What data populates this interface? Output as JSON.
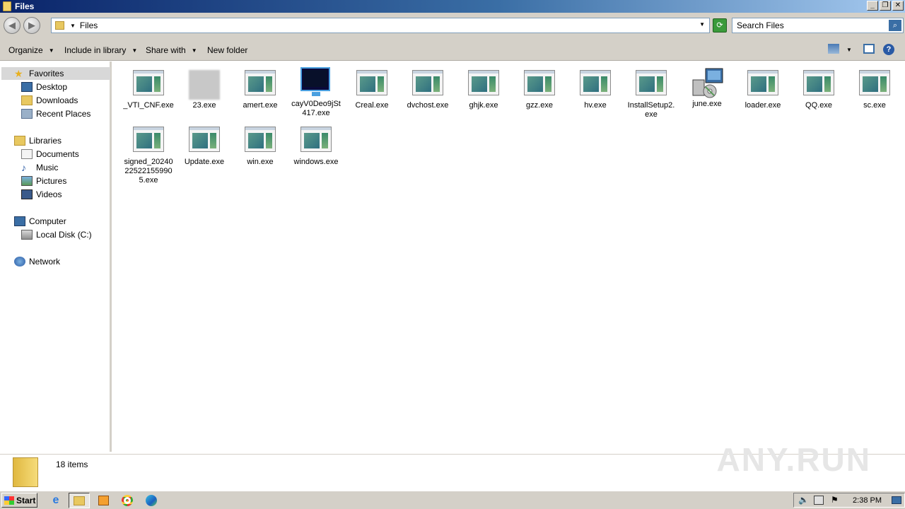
{
  "window": {
    "title": "Files",
    "buttons": {
      "minimize": "_",
      "restore": "❐",
      "close": "✕"
    }
  },
  "address": {
    "path": "Files",
    "search_placeholder": "Search Files"
  },
  "toolbar": {
    "organize": "Organize",
    "include_in_library": "Include in library",
    "share_with": "Share with",
    "new_folder": "New folder"
  },
  "nav": {
    "favorites": "Favorites",
    "desktop": "Desktop",
    "downloads": "Downloads",
    "recent_places": "Recent Places",
    "libraries": "Libraries",
    "documents": "Documents",
    "music": "Music",
    "pictures": "Pictures",
    "videos": "Videos",
    "computer": "Computer",
    "local_disk": "Local Disk (C:)",
    "network": "Network"
  },
  "files": [
    {
      "name": "_VTI_CNF.exe",
      "icon": "exe-icon"
    },
    {
      "name": "23.exe",
      "icon": "blurred-icon"
    },
    {
      "name": "amert.exe",
      "icon": "exe-icon"
    },
    {
      "name": "cayV0Deo9jSt417.exe",
      "icon": "monitor-icon"
    },
    {
      "name": "Creal.exe",
      "icon": "exe-icon"
    },
    {
      "name": "dvchost.exe",
      "icon": "exe-icon"
    },
    {
      "name": "ghjk.exe",
      "icon": "exe-icon"
    },
    {
      "name": "gzz.exe",
      "icon": "exe-icon"
    },
    {
      "name": "hv.exe",
      "icon": "exe-icon"
    },
    {
      "name": "InstallSetup2.exe",
      "icon": "exe-icon"
    },
    {
      "name": "june.exe",
      "icon": "setup-icon"
    },
    {
      "name": "loader.exe",
      "icon": "exe-icon"
    },
    {
      "name": "QQ.exe",
      "icon": "exe-icon"
    },
    {
      "name": "sc.exe",
      "icon": "exe-icon"
    },
    {
      "name": "signed_20240225221559905.exe",
      "icon": "exe-icon"
    },
    {
      "name": "Update.exe",
      "icon": "exe-icon"
    },
    {
      "name": "win.exe",
      "icon": "exe-icon"
    },
    {
      "name": "windows.exe",
      "icon": "exe-icon"
    }
  ],
  "status": {
    "item_count": "18 items"
  },
  "watermark": "ANY.RUN",
  "taskbar": {
    "start": "Start",
    "clock": "2:38 PM"
  },
  "colors": {
    "title_gradient_start": "#0a246a",
    "chrome": "#d4d0c8",
    "selection": "#d8d8d8"
  }
}
